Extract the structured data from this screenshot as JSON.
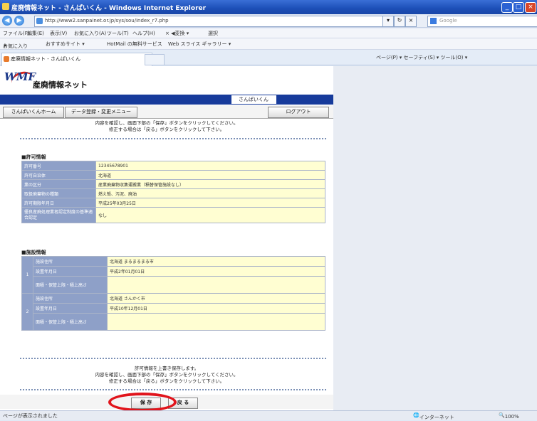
{
  "window": {
    "title": "産廃情報ネット - さんぱいくん - Windows Internet Explorer",
    "min": "_",
    "max": "□",
    "close": "×"
  },
  "address": {
    "url": "http://www2.sanpainet.or.jp/sys/sou/index_r7.php",
    "search_placeholder": "Google"
  },
  "menu": [
    "ファイル(F)",
    "編集(E)",
    "表示(V)",
    "お気に入り(A)",
    "ツール(T)",
    "ヘルプ(H)",
    "× ◀変換 ▾",
    "選択"
  ],
  "favorites": {
    "label": "お気に入り",
    "items": [
      "おすすめサイト ▾",
      "HotMail の無料サービス",
      "Web スライス ギャラリー ▾"
    ]
  },
  "tab": {
    "title": "産廃情報ネット - さんぱいくん"
  },
  "commandbar": "ページ(P) ▾  セーフティ(S) ▾  ツール(O) ▾",
  "site": {
    "logo_mark": "WMF",
    "logo_name": "産廃情報ネット",
    "user_label": "さんぱいくん",
    "nav": {
      "home": "さんぱいくんホーム",
      "menu": "データ登録・変更メニュー",
      "logout": "ログアウト"
    }
  },
  "top_message": [
    "内容を確認し、画面下部の「保存」ボタンをクリックしてください。",
    "修正する場合は「戻る」ボタンをクリックして下さい。"
  ],
  "permit": {
    "heading": "■許可情報",
    "rows": [
      {
        "label": "許可番号",
        "value": "12345678901"
      },
      {
        "label": "許可自治体",
        "value": "北海道"
      },
      {
        "label": "業の区分",
        "value": "産業廃棄物収集運搬業（積替保管施設なし）"
      },
      {
        "label": "取扱廃棄物の種類",
        "value": "燃え殻、汚泥、廃油"
      },
      {
        "label": "許可期限年月日",
        "value": "平成25年03月25日"
      },
      {
        "label": "優良産廃処理業者認定制度の基準適合認定",
        "value": "なし"
      }
    ]
  },
  "facility": {
    "heading": "■施設情報",
    "groups": [
      {
        "index": "1",
        "rows": [
          {
            "label": "施設住所",
            "value": "北海道 まるまるまる市"
          },
          {
            "label": "設置年月日",
            "value": "平成2年01月01日"
          },
          {
            "label": "面積・保管上限・積上高さ",
            "value": ""
          }
        ]
      },
      {
        "index": "2",
        "rows": [
          {
            "label": "施設住所",
            "value": "北海道 さんかく市"
          },
          {
            "label": "設置年月日",
            "value": "平成10年12月01日"
          },
          {
            "label": "面積・保管上限・積上高さ",
            "value": ""
          }
        ]
      }
    ]
  },
  "bottom_message": [
    "許可情報を上書き保存します。",
    "内容を確認し、画面下部の「保存」ボタンをクリックしてください。",
    "修正する場合は「戻る」ボタンをクリックして下さい。"
  ],
  "buttons": {
    "save": "保 存",
    "back": "戻 る"
  },
  "status": {
    "left": "ページが表示されました",
    "zone": "インターネット",
    "zoom": "100%"
  }
}
